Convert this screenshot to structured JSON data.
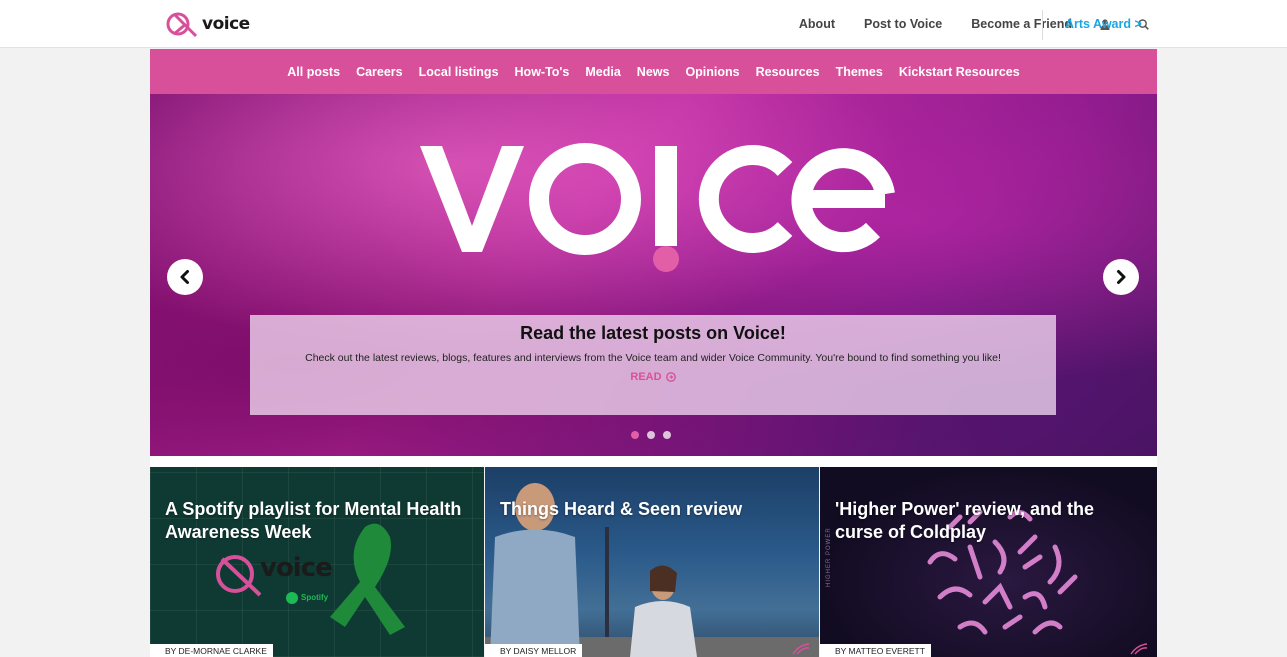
{
  "header": {
    "logo_text": "voice",
    "nav": [
      {
        "label": "About"
      },
      {
        "label": "Post to Voice"
      },
      {
        "label": "Become a Friend"
      }
    ],
    "icons": [
      "user-icon",
      "search-icon"
    ],
    "arts_award": "Arts Award",
    "arts_award_chevron": ">"
  },
  "categories": [
    "All posts",
    "Careers",
    "Local listings",
    "How-To's",
    "Media",
    "News",
    "Opinions",
    "Resources",
    "Themes",
    "Kickstart Resources"
  ],
  "hero": {
    "logo_word": "VOICE",
    "caption_title": "Read the latest posts on Voice!",
    "caption_text": "Check out the latest reviews, blogs, features and interviews from the Voice team and wider Voice Community. You're bound to find something you like!",
    "read_label": "READ",
    "slides": 3,
    "active_slide": 1
  },
  "cards": [
    {
      "title": "A Spotify playlist for Mental Health Awareness Week",
      "byline": "BY DE-MORNAE CLARKE",
      "inner_logo": "voice",
      "inner_label": "Spotify"
    },
    {
      "title": "Things Heard & Seen review",
      "byline": "BY DAISY MELLOR"
    },
    {
      "title": "'Higher Power' review, and the curse of Coldplay",
      "byline": "BY MATTEO EVERETT",
      "side_text": "HIGHER POWER"
    }
  ],
  "colors": {
    "brand_pink": "#d9509a",
    "arts_award_blue": "#1aa6e0"
  }
}
